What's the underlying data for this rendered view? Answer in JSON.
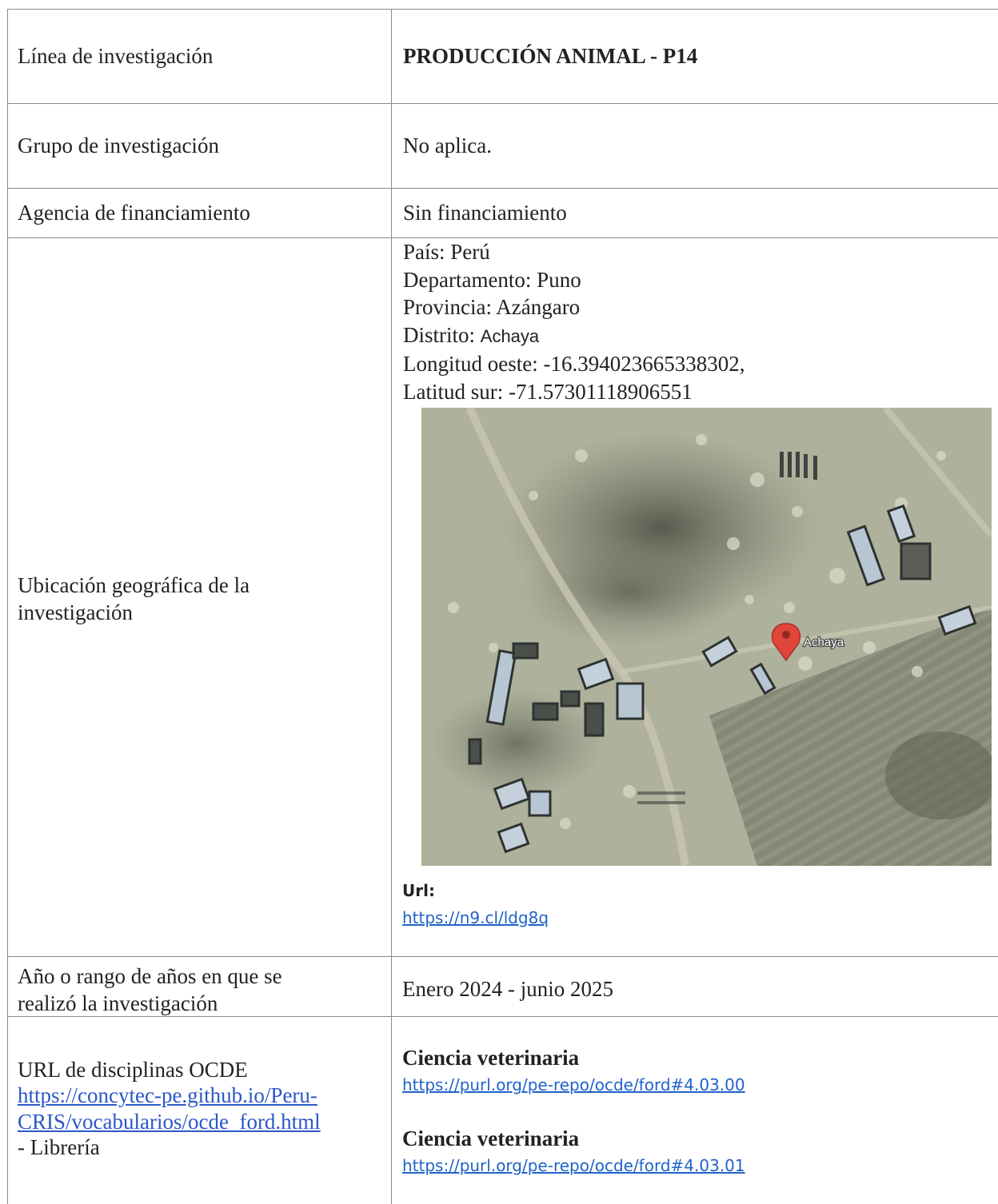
{
  "rows": {
    "linea": {
      "label": "Línea de investigación",
      "value": "PRODUCCIÓN ANIMAL - P14"
    },
    "grupo": {
      "label": "Grupo de investigación",
      "value": "No aplica."
    },
    "agencia": {
      "label": "Agencia de financiamiento",
      "value": "Sin financiamiento"
    },
    "ubicacion": {
      "label_line1": "Ubicación geográfica de la",
      "label_line2": "investigación",
      "pais": "País: Perú",
      "departamento": "Departamento: Puno",
      "provincia": "Provincia: Azángaro",
      "distrito_label": "Distrito: ",
      "distrito_value": "Achaya",
      "longitud": "Longitud oeste: -16.394023665338302,",
      "latitud": "Latitud sur: -71.57301118906551",
      "map_place_label": "Achaya",
      "url_label": "Url:",
      "url": "https://n9.cl/ldg8q"
    },
    "anio": {
      "label_line1": "Año o rango de años en que se",
      "label_line2": "realizó la investigación",
      "value": "Enero 2024 - junio 2025"
    },
    "ocde": {
      "label_line1": "URL de disciplinas OCDE",
      "link_line1": "https://concytec-pe.github.io/Peru-",
      "link_line2": "CRIS/vocabularios/ocde_ford.html",
      "label_line4": "- Librería",
      "disciplines": [
        {
          "name": "Ciencia veterinaria",
          "url": "https://purl.org/pe-repo/ocde/ford#4.03.00"
        },
        {
          "name": "Ciencia veterinaria",
          "url": "https://purl.org/pe-repo/ocde/ford#4.03.01"
        }
      ]
    }
  },
  "colors": {
    "link": "#1f63c8",
    "rule": "#8a8a8a",
    "pin": "#e0453a"
  },
  "icons": {
    "map_pin": "map-pin-icon"
  }
}
